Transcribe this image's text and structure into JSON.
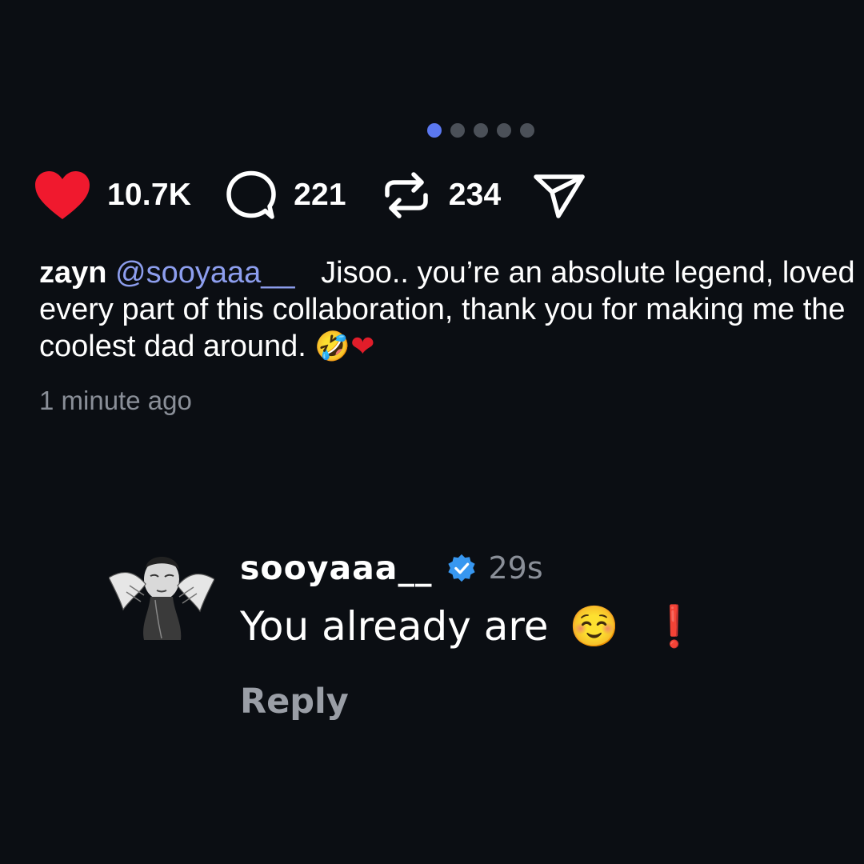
{
  "carousel": {
    "total_pages": 5,
    "active_index": 1
  },
  "actions": {
    "likes": "10.7K",
    "comments": "221",
    "reposts": "234"
  },
  "caption": {
    "author": "zayn",
    "mention": "@sooyaaa__",
    "text": "Jisoo.. you’re an absolute legend, loved every part of this collaboration, thank you for making me the coolest dad around.",
    "emoji_laugh": "🤣",
    "emoji_heart": "❤"
  },
  "time_ago": "1 minute ago",
  "reply": {
    "username": "sooyaaa__",
    "time": "29s",
    "text": "You already are",
    "emoji_smile": "☺️",
    "emoji_exclaim": "❗"
  },
  "reply_button": "Reply",
  "colors": {
    "background": "#0b0e13",
    "like_red": "#f0192e",
    "mention": "#8d9eee",
    "active_dot": "#5b78f0",
    "verified_blue": "#3797f0",
    "muted_text": "#8a8f98"
  }
}
